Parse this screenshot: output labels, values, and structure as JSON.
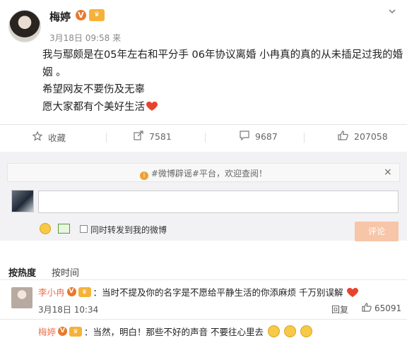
{
  "post": {
    "author": "梅婷",
    "verified_mark": "V",
    "level_badge": "♛",
    "time": "3月18日 09:58 来",
    "paragraphs": [
      "我与鄢颇是在05年左右和平分手  06年协议离婚  小冉真的真的从未插足过我的婚",
      "姻 。",
      "希望网友不要伤及无辜",
      "愿大家都有个美好生活"
    ]
  },
  "actions": {
    "favorite": "收藏",
    "repost": "7581",
    "comment": "9687",
    "like": "207058"
  },
  "comment_box": {
    "notice": "#微博辟谣#平台，欢迎查阅！",
    "notice_close": "×",
    "input_value": "",
    "repost_label": "同时转发到我的微博",
    "send_label": "评论"
  },
  "sort": {
    "hot": "按热度",
    "time": "按时间"
  },
  "comments": [
    {
      "name": "李小冉",
      "verified_mark": "V",
      "level_badge": "♛",
      "text": "：当时不提及你的名字是不愿给平静生活的你添麻烦  千万别误解",
      "time": "3月18日 10:34",
      "reply": "回复",
      "likes": "65091"
    },
    {
      "name": "梅婷",
      "verified_mark": "V",
      "level_badge": "♛",
      "text": "：当然，明白！那些不好的声音 不要往心里去"
    }
  ],
  "colors": {
    "heart": "#e8432e",
    "name_link": "#eb7350",
    "verified": "#e8792c",
    "send_button": "#f7c5a8"
  }
}
